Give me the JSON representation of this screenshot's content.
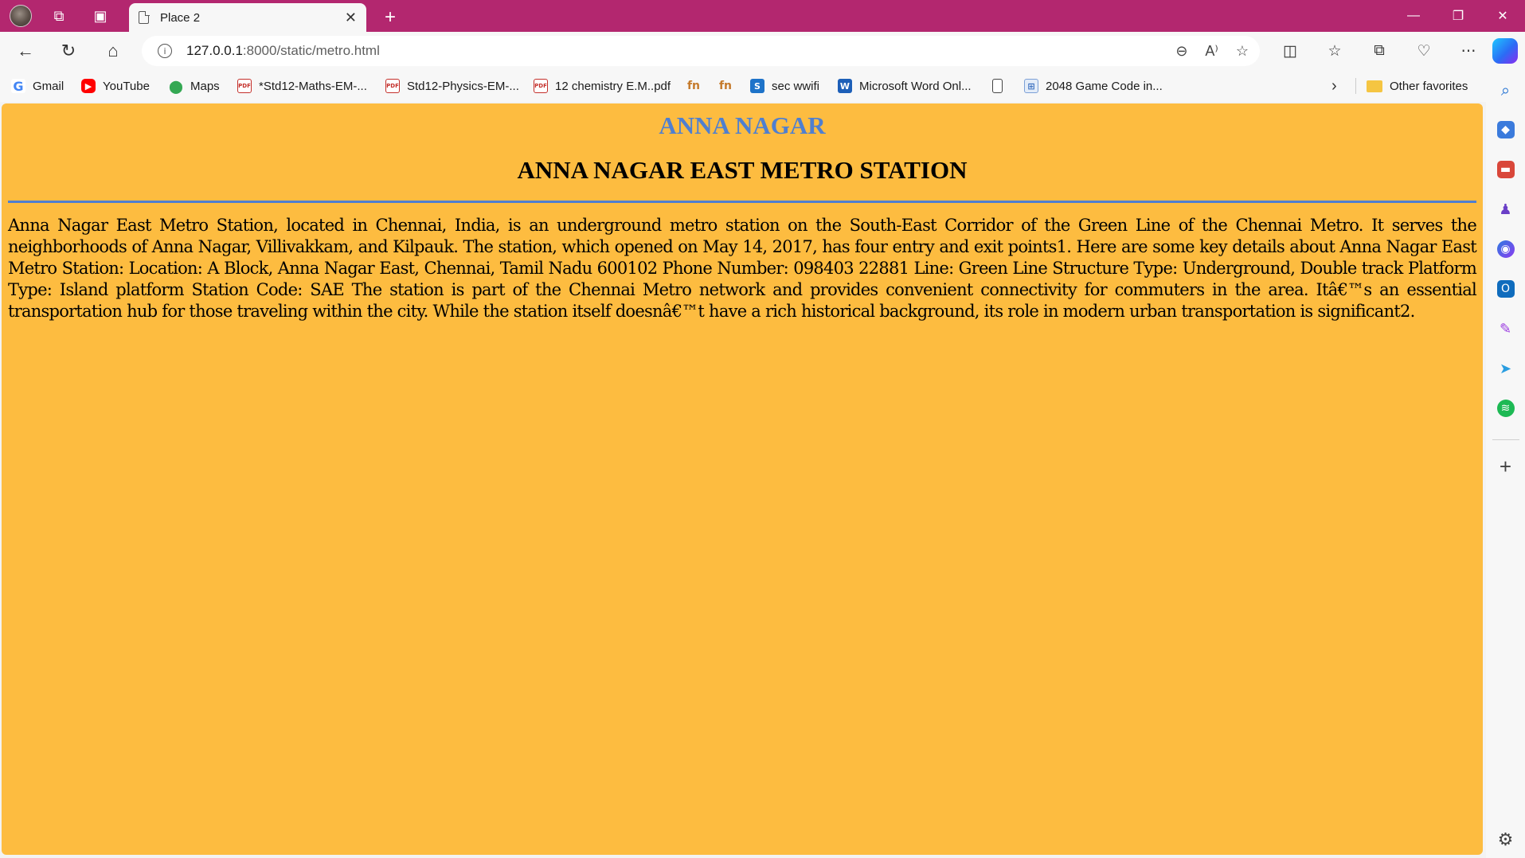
{
  "browser": {
    "tab": {
      "title": "Place 2",
      "close": "✕"
    },
    "new_tab": "+",
    "window_controls": {
      "minimize": "—",
      "restore": "❐",
      "close": "✕"
    },
    "nav": {
      "back": "←",
      "reload": "↻",
      "home": "⌂"
    },
    "url": {
      "host": "127.0.0.1",
      "path": ":8000/static/metro.html"
    },
    "omnibox_icons": [
      "zoom-out-icon",
      "read-aloud-icon",
      "favorite-star-icon"
    ],
    "toolbar_icons": [
      "split-screen-icon",
      "favorites-icon",
      "collections-icon",
      "browser-essentials-icon",
      "more-icon",
      "copilot-icon"
    ]
  },
  "favorites": [
    {
      "label": "Gmail",
      "icon": "google-icon"
    },
    {
      "label": "YouTube",
      "icon": "youtube-icon"
    },
    {
      "label": "Maps",
      "icon": "maps-icon"
    },
    {
      "label": "*Std12-Maths-EM-...",
      "icon": "pdf-icon"
    },
    {
      "label": "Std12-Physics-EM-...",
      "icon": "pdf-icon"
    },
    {
      "label": "12 chemistry E.M..pdf",
      "icon": "pdf-icon"
    },
    {
      "label": "",
      "icon": "fn-icon"
    },
    {
      "label": "",
      "icon": "fn-icon"
    },
    {
      "label": "sec wwifi",
      "icon": "s-icon"
    },
    {
      "label": "Microsoft Word Onl...",
      "icon": "word-icon"
    },
    {
      "label": "",
      "icon": "document-icon"
    },
    {
      "label": "2048 Game Code in...",
      "icon": "game-icon"
    },
    {
      "label": "Other favorites",
      "icon": "folder-icon"
    }
  ],
  "page": {
    "place_heading": "ANNA NAGAR",
    "station_heading": "ANNA NAGAR EAST METRO STATION",
    "description": "Anna Nagar East Metro Station, located in Chennai, India, is an underground metro station on the South-East Corridor of the Green Line of the Chennai Metro. It serves the neighborhoods of Anna Nagar, Villivakkam, and Kilpauk. The station, which opened on May 14, 2017, has four entry and exit points1. Here are some key details about Anna Nagar East Metro Station: Location: A Block, Anna Nagar East, Chennai, Tamil Nadu 600102 Phone Number: 098403 22881 Line: Green Line Structure Type: Underground, Double track Platform Type: Island platform Station Code: SAE The station is part of the Chennai Metro network and provides convenient connectivity for commuters in the area. Itâ€™s an essential transportation hub for those traveling within the city. While the station itself doesnâ€™t have a rich historical background, its role in modern urban transportation is significant2."
  },
  "colors": {
    "titlebar": "#b3276f",
    "page_background": "#fdbc40",
    "heading_accent": "#4f7fd0"
  },
  "sidebar_icons": [
    "search-icon",
    "shopping-tag-icon",
    "tools-icon",
    "games-icon",
    "microsoft365-icon",
    "outlook-icon",
    "designer-icon",
    "send-icon",
    "spotify-icon"
  ],
  "sidebar_add": "+",
  "sidebar_settings": "⚙"
}
